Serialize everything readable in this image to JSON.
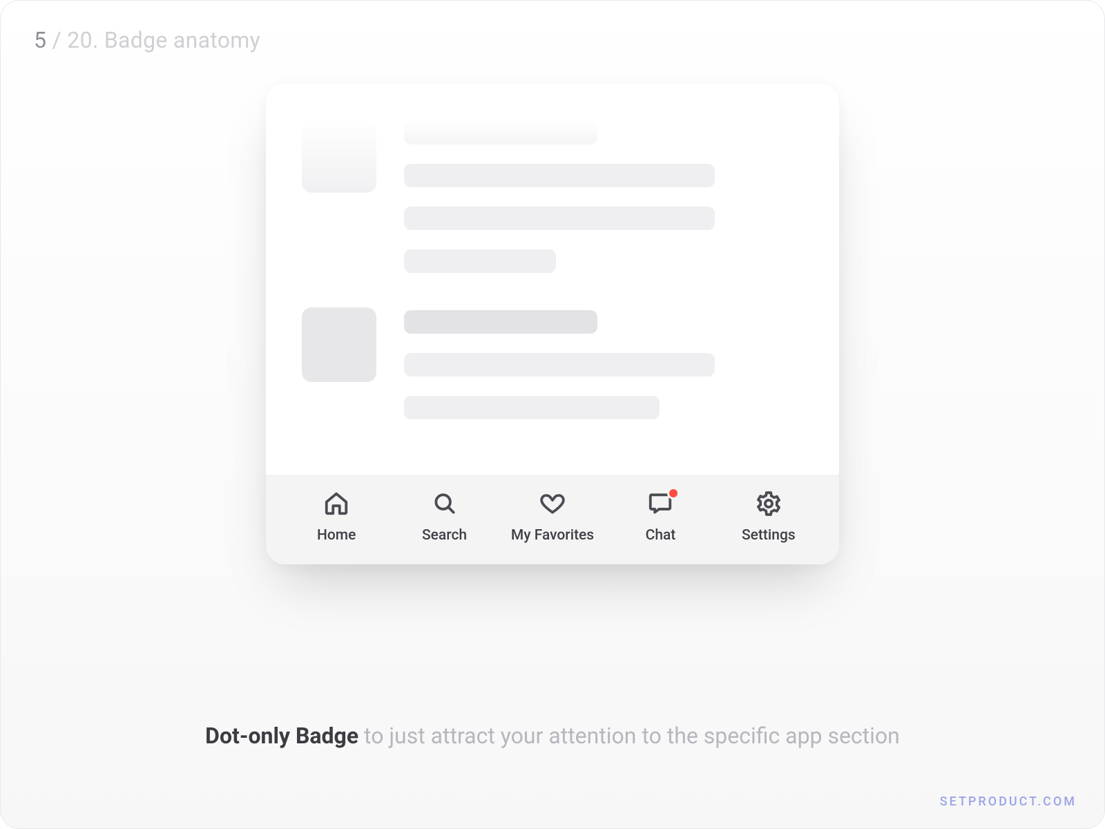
{
  "slide": {
    "current": "5",
    "separator": " / ",
    "total_and_title": "20. Badge anatomy"
  },
  "nav": {
    "items": [
      {
        "label": "Home",
        "icon": "home-icon",
        "badge": false
      },
      {
        "label": "Search",
        "icon": "search-icon",
        "badge": false
      },
      {
        "label": "My Favorites",
        "icon": "heart-icon",
        "badge": false
      },
      {
        "label": "Chat",
        "icon": "chat-icon",
        "badge": true
      },
      {
        "label": "Settings",
        "icon": "gear-icon",
        "badge": false
      }
    ]
  },
  "caption": {
    "strong": "Dot-only Badge",
    "rest": " to just attract your attention to the specific app section"
  },
  "watermark": "SETPRODUCT.COM",
  "badge_color": "#ff4d3d"
}
